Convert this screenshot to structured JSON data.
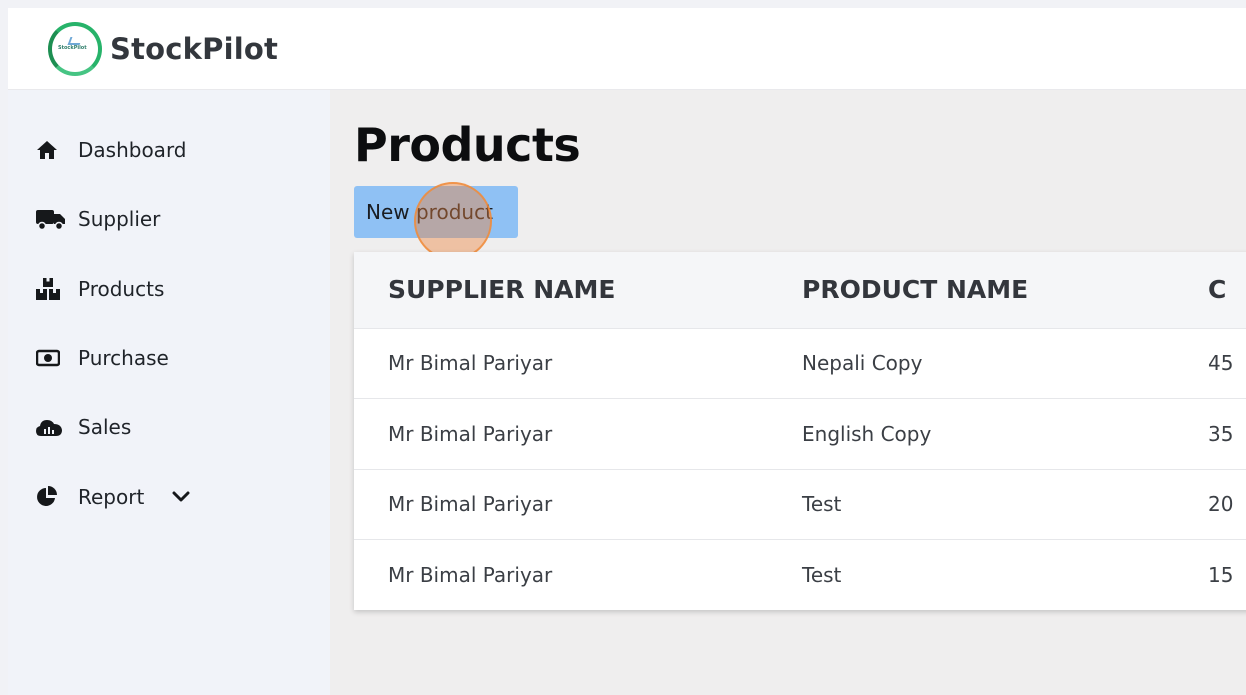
{
  "app": {
    "brand": "StockPilot",
    "logo_text": "StockPilot"
  },
  "sidebar": {
    "items": [
      {
        "label": "Dashboard",
        "icon": "home-icon"
      },
      {
        "label": "Supplier",
        "icon": "truck-icon"
      },
      {
        "label": "Products",
        "icon": "boxes-icon"
      },
      {
        "label": "Purchase",
        "icon": "money-bill-icon"
      },
      {
        "label": "Sales",
        "icon": "chart-cloud-icon"
      },
      {
        "label": "Report",
        "icon": "pie-chart-icon",
        "expand_icon": "chevron-down-icon"
      }
    ]
  },
  "main": {
    "title": "Products",
    "new_button_label": "New product",
    "table": {
      "headers": [
        "SUPPLIER NAME",
        "PRODUCT NAME",
        "C"
      ],
      "rows": [
        [
          "Mr Bimal Pariyar",
          "Nepali Copy",
          "45"
        ],
        [
          "Mr Bimal Pariyar",
          "English Copy",
          "35"
        ],
        [
          "Mr Bimal Pariyar",
          "Test",
          "20"
        ],
        [
          "Mr Bimal Pariyar",
          "Test",
          "15"
        ]
      ]
    }
  },
  "colors": {
    "primary_button": "#8fc1f4",
    "sidebar_bg": "#f1f3f9",
    "main_bg": "#efeeee",
    "logo_ring": "#27b36a",
    "click_highlight": "#eb823c"
  }
}
